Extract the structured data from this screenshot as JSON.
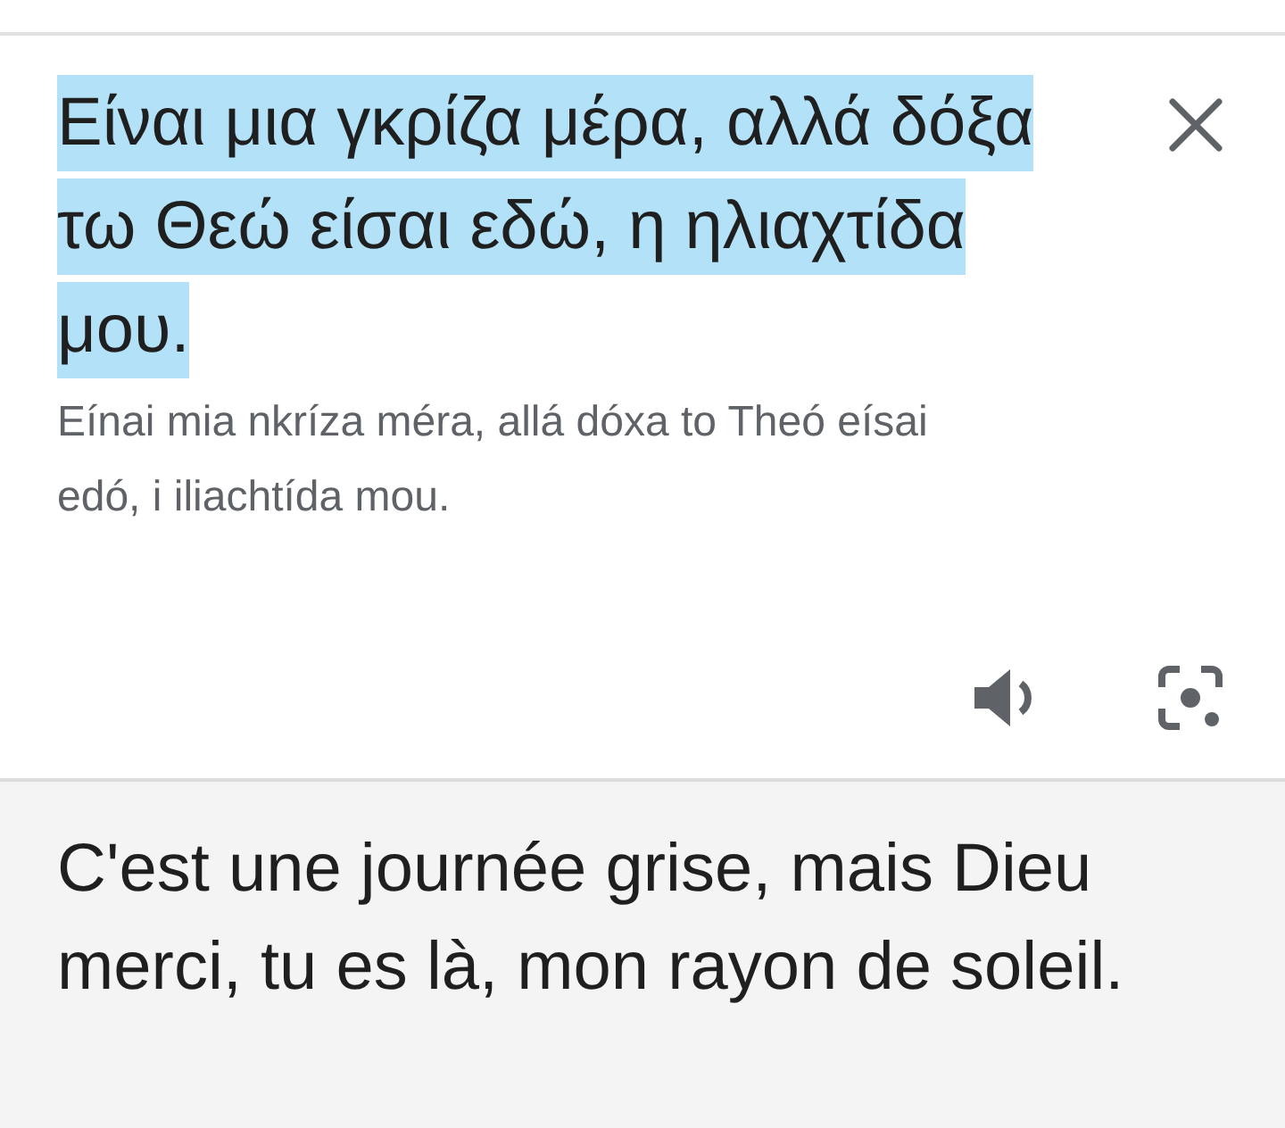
{
  "source": {
    "text": "Είναι μια γκρίζα μέρα, αλλά δόξα τω Θεώ είσαι εδώ, η ηλιαχτίδα μου.",
    "selected": true
  },
  "transliteration": "Eínai mia nkríza méra, allá dóxa to Theó eísai edó, i iliachtída mou.",
  "translation": "C'est une journée grise, mais Dieu merci, tu es là, mon rayon de soleil."
}
